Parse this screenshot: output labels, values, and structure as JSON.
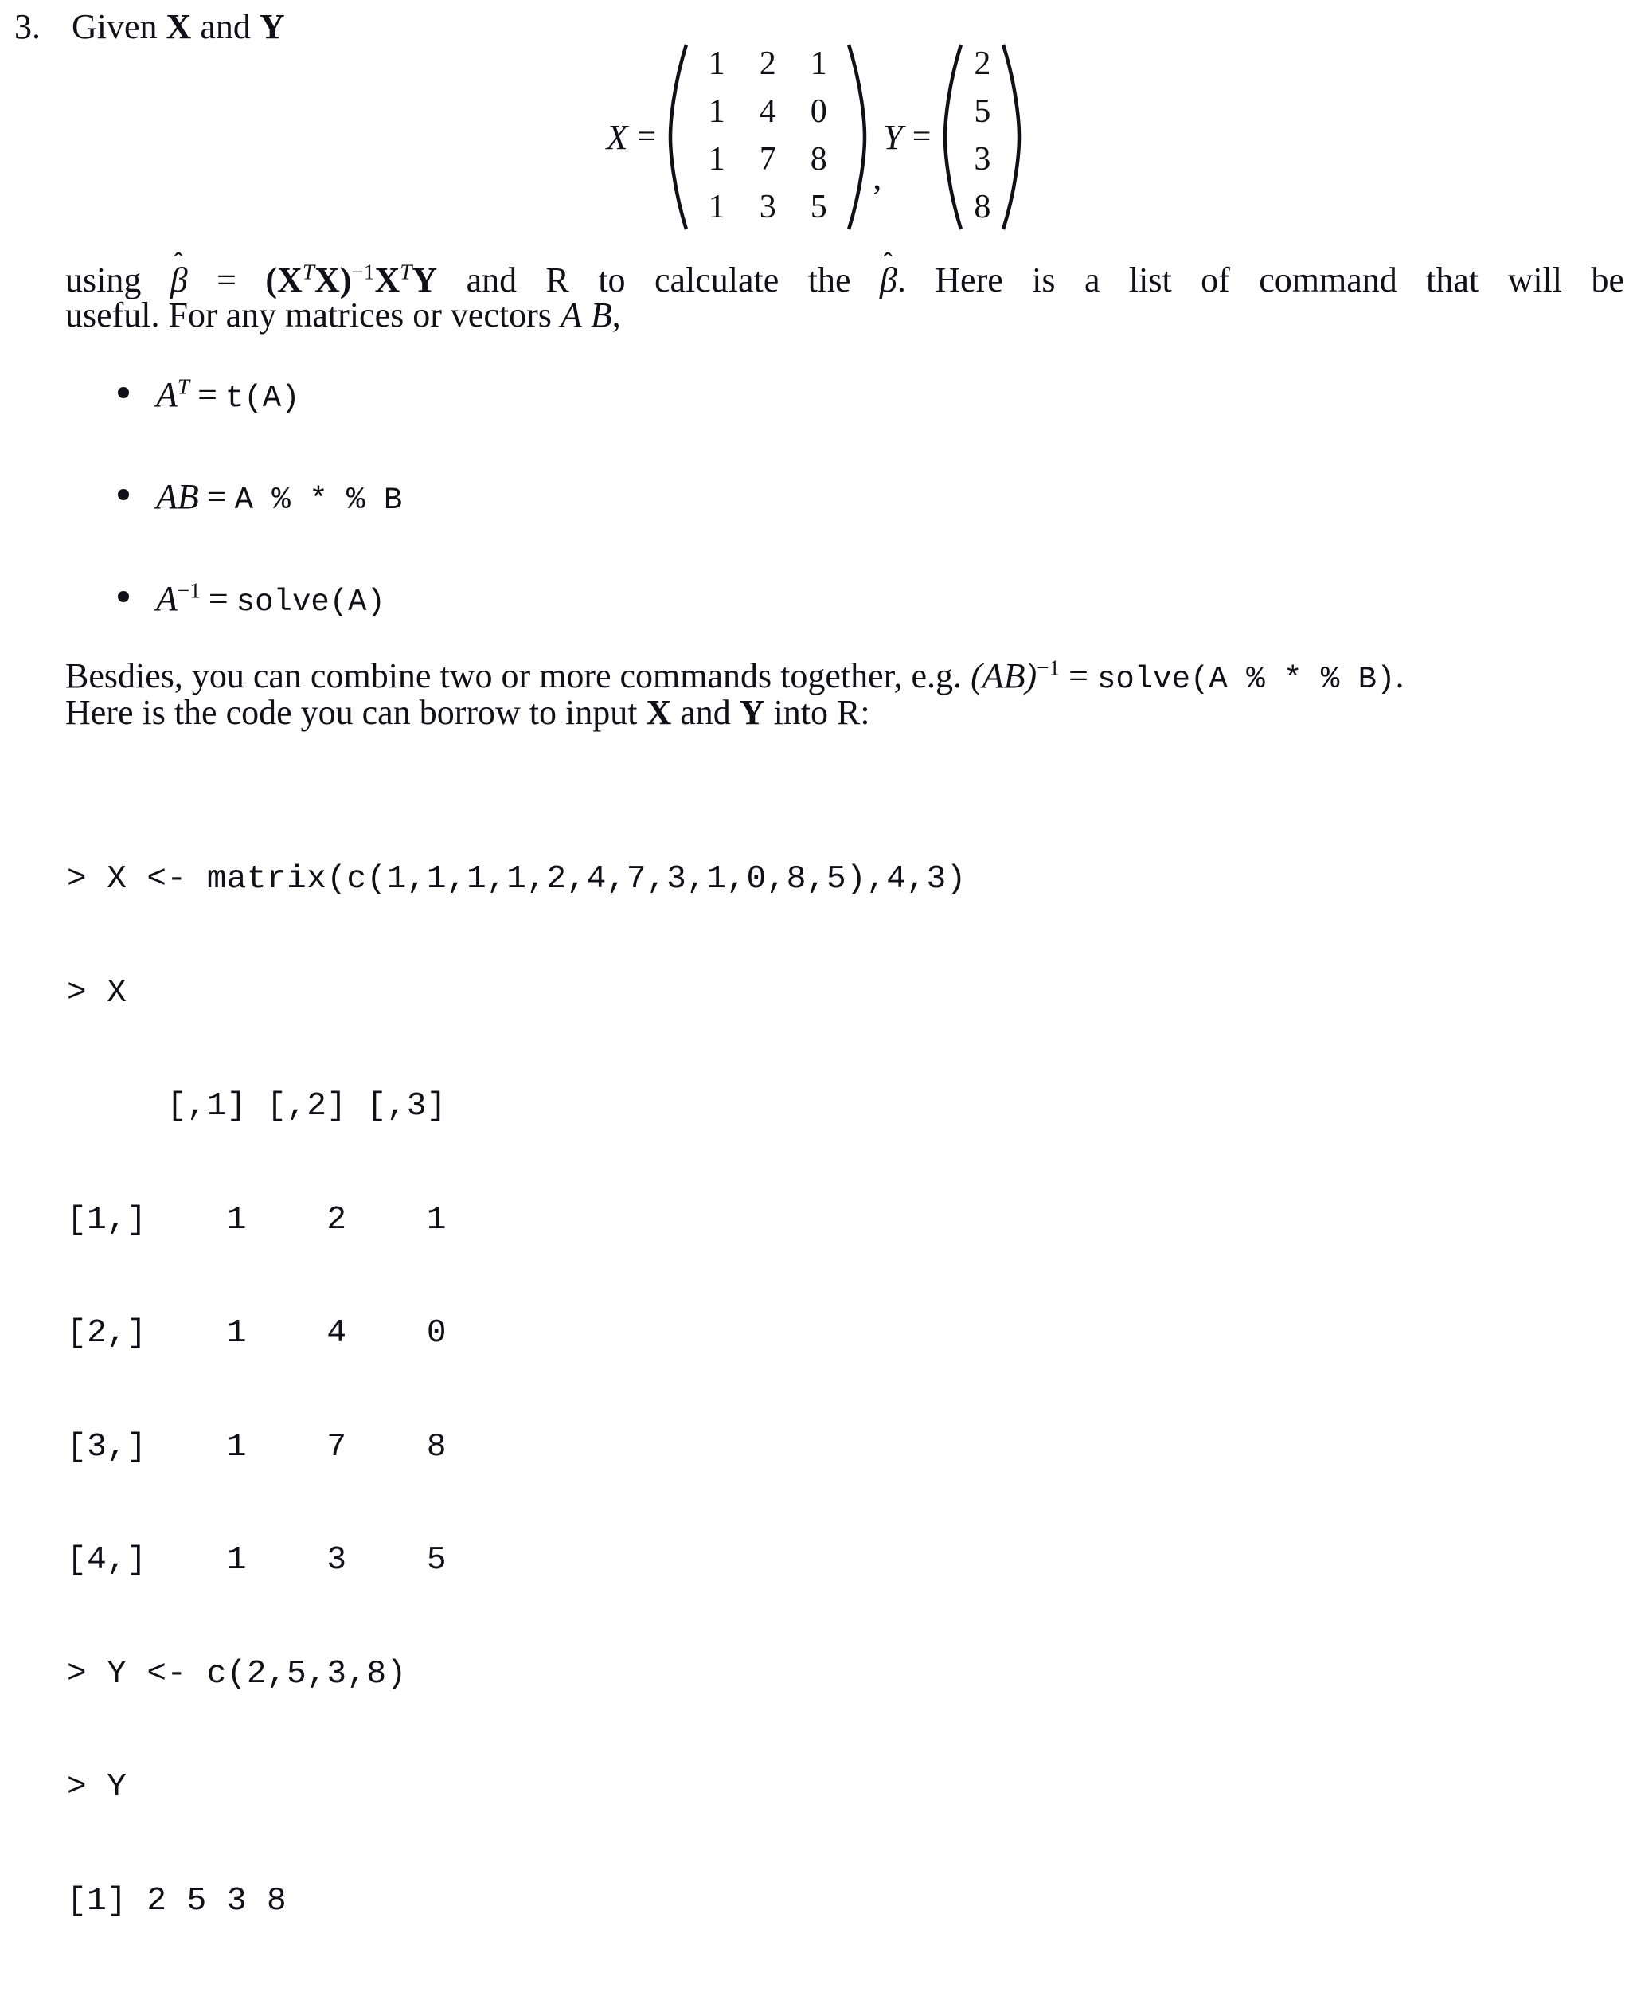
{
  "problem": {
    "number": "3.",
    "stem_before": "Given ",
    "stem_x": "X",
    "stem_and": " and ",
    "stem_y": "Y"
  },
  "display_math": {
    "x_label": "X",
    "equals": "=",
    "comma": ",",
    "y_label": "Y",
    "matrix_x": [
      [
        "1",
        "2",
        "1"
      ],
      [
        "1",
        "4",
        "0"
      ],
      [
        "1",
        "7",
        "8"
      ],
      [
        "1",
        "3",
        "5"
      ]
    ],
    "vector_y": [
      "2",
      "5",
      "3",
      "8"
    ]
  },
  "paragraph_using": {
    "line1_a": "using ",
    "beta_hat": "β",
    "beta_hat_accent": "ˆ",
    "eq": " = ",
    "formula": "(X",
    "formula_t1": "T",
    "formula_mid": "X)",
    "formula_inv": "−1",
    "formula_x2": "X",
    "formula_t2": "T",
    "formula_y": "Y",
    "line1_b": " and R to calculate the ",
    "line1_c": ".  Here is a list of command that will be",
    "line2": "useful.  For any matrices or vectors ",
    "line2_a": "A",
    "line2_b": "B",
    "line2_c": ","
  },
  "bullets": [
    {
      "math_base": "A",
      "math_exp": "T",
      "equals": "=",
      "code": "t(A)"
    },
    {
      "math_base": "AB",
      "math_exp": "",
      "equals": "=",
      "code": "A % * % B"
    },
    {
      "math_base": "A",
      "math_exp": "−1",
      "equals": "=",
      "code": "solve(A)"
    }
  ],
  "paragraph_besides": {
    "line1_a": "Besdies, you can combine two or more commands together, e.g. ",
    "line1_math": "(AB)",
    "line1_exp": "−1",
    "line1_eq": " = ",
    "line1_code": "solve(A % * % B)",
    "line1_end": ".",
    "line2_a": "Here is the code you can borrow to input ",
    "line2_x": "X",
    "line2_mid": " and ",
    "line2_y": "Y",
    "line2_end": " into R:"
  },
  "code_block": {
    "lines": [
      "> X <- matrix(c(1,1,1,1,2,4,7,3,1,0,8,5),4,3)",
      "> X",
      "     [,1] [,2] [,3]",
      "[1,]    1    2    1",
      "[2,]    1    4    0",
      "[3,]    1    7    8",
      "[4,]    1    3    5",
      "> Y <- c(2,5,3,8)",
      "> Y",
      "[1] 2 5 3 8"
    ]
  },
  "chart_data": {
    "type": "table",
    "title": "R console output of matrix X and vector Y",
    "columns": [
      "",
      "[,1]",
      "[,2]",
      "[,3]"
    ],
    "rows": [
      [
        "[1,]",
        1,
        2,
        1
      ],
      [
        "[2,]",
        1,
        4,
        0
      ],
      [
        "[3,]",
        1,
        7,
        8
      ],
      [
        "[4,]",
        1,
        3,
        5
      ]
    ],
    "vector_y": [
      2,
      5,
      3,
      8
    ]
  }
}
